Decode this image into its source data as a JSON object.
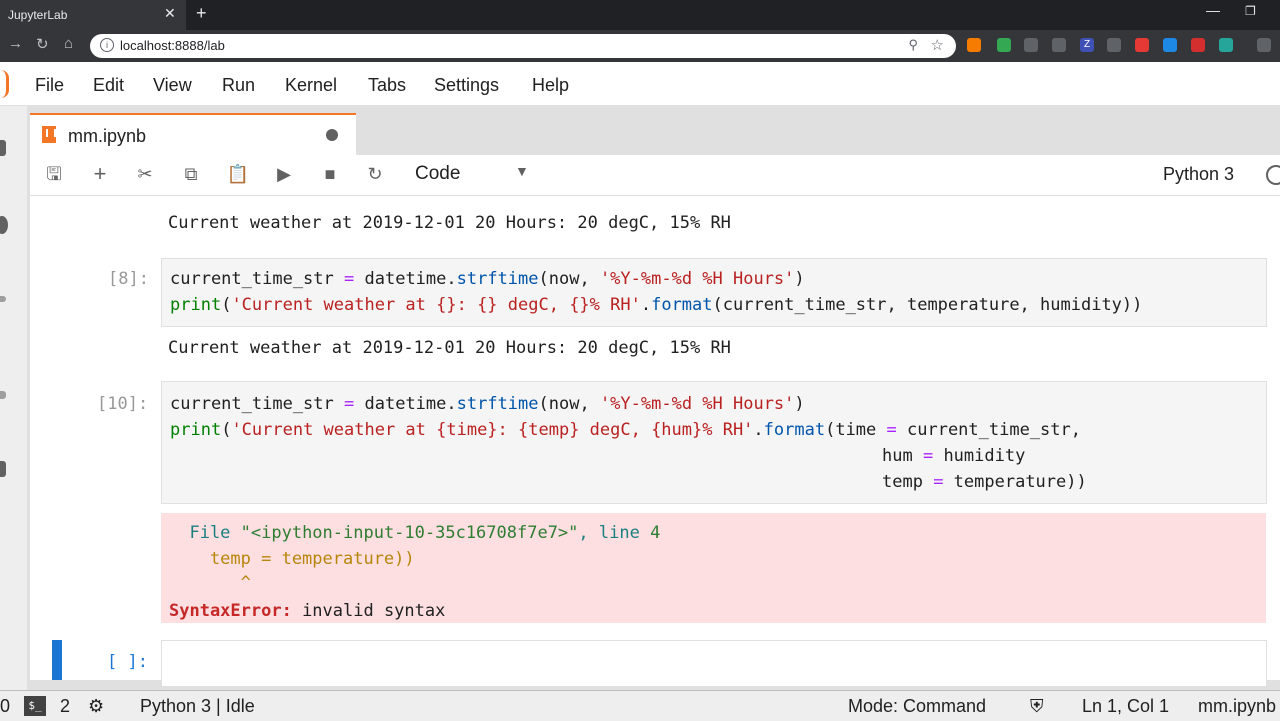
{
  "browser": {
    "tab_title": "JupyterLab",
    "close_glyph": "✕",
    "new_tab_glyph": "+",
    "url": "localhost:8888/lab"
  },
  "menu": [
    "File",
    "Edit",
    "View",
    "Run",
    "Kernel",
    "Tabs",
    "Settings",
    "Help"
  ],
  "document_tab": {
    "name": "mm.ipynb"
  },
  "toolbar": {
    "cell_type": "Code",
    "kernel": "Python 3"
  },
  "cells": {
    "prev_output": "Current weather at 2019-12-01 20 Hours: 20 degC, 15% RH",
    "cell8": {
      "prompt": "[8]:",
      "output": "Current weather at 2019-12-01 20 Hours: 20 degC, 15% RH"
    },
    "cell10": {
      "prompt": "[10]:",
      "error_file_pre": "  File ",
      "error_file_str": "\"<ipython-input-10-35c16708f7e7>\"",
      "error_file_mid": ", line ",
      "error_file_line": "4",
      "error_code": "    temp = temperature))",
      "error_caret": "       ^",
      "error_name": "SyntaxError:",
      "error_msg": " invalid syntax"
    },
    "empty_prompt": "[ ]:"
  },
  "status": {
    "left_num": "0",
    "term_label": "$_",
    "term_count": "2",
    "kernel_state": "Python 3 | Idle",
    "mode": "Mode: Command",
    "cursor": "Ln 1, Col 1",
    "file": "mm.ipynb"
  },
  "colors": {
    "accent": "#f37626",
    "active_cell": "#1976d2",
    "error_bg": "#fddfe1"
  }
}
